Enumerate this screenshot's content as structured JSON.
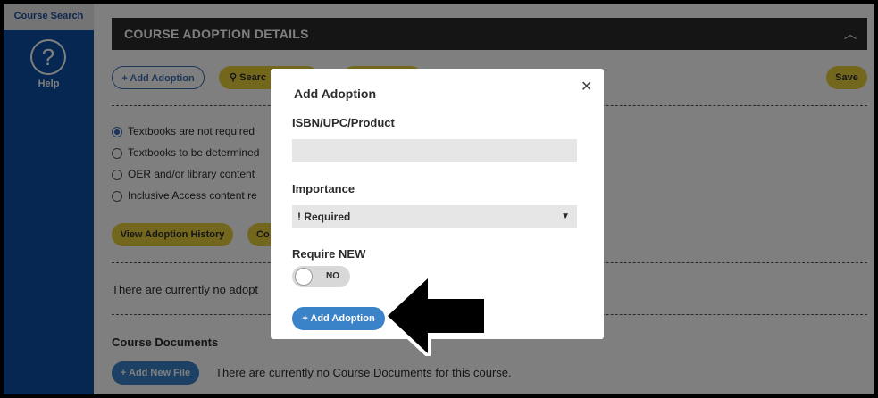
{
  "sidebar": {
    "tab_label": "Course Search",
    "help_label": "Help",
    "help_icon": "question-circle-icon"
  },
  "header": {
    "title": "COURSE ADOPTION DETAILS",
    "collapse_icon": "chevron-up-icon"
  },
  "toolbar": {
    "add_adoption": "+ Add Adoption",
    "search": "Searc",
    "save": "Save"
  },
  "options": [
    {
      "text": "Textbooks are not required",
      "selected": true
    },
    {
      "text": "Textbooks to be determined",
      "selected": false
    },
    {
      "text": "OER and/or library content",
      "selected": false
    },
    {
      "text": "Inclusive Access content re",
      "selected": false
    }
  ],
  "actions": {
    "view_history": "View Adoption History",
    "copy": "Co"
  },
  "adoptions_status": "There are currently no adopt",
  "documents": {
    "title": "Course Documents",
    "add_file": "+ Add New File",
    "empty_text": "There are currently no Course Documents for this course."
  },
  "modal": {
    "title": "Add Adoption",
    "close_icon": "close-icon",
    "isbn_label": "ISBN/UPC/Product",
    "isbn_value": "",
    "importance_label": "Importance",
    "importance_value": "! Required",
    "require_label_prefix": "Require ",
    "require_label_strong": "NEW",
    "toggle_value": "NO",
    "add_button": "+ Add Adoption"
  },
  "colors": {
    "sidebar": "#0b4ea2",
    "accent_blue": "#3b83c9",
    "accent_yellow": "#e7cf3a",
    "header": "#2b2b2b"
  }
}
